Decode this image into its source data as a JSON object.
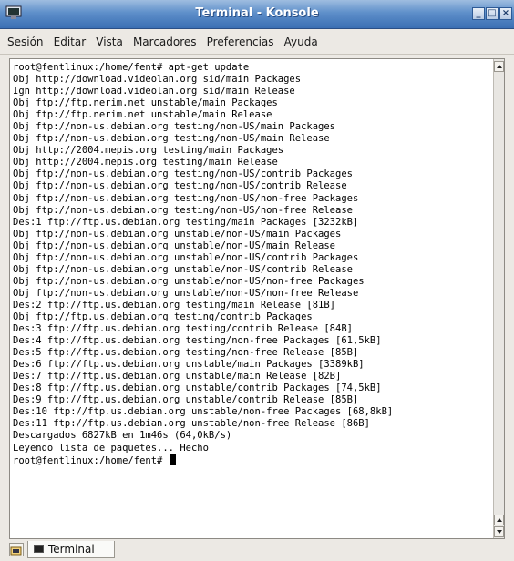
{
  "window": {
    "title": "Terminal - Konsole"
  },
  "menu": [
    "Sesión",
    "Editar",
    "Vista",
    "Marcadores",
    "Preferencias",
    "Ayuda"
  ],
  "terminal": {
    "lines": [
      "root@fentlinux:/home/fent# apt-get update",
      "Obj http://download.videolan.org sid/main Packages",
      "Ign http://download.videolan.org sid/main Release",
      "Obj ftp://ftp.nerim.net unstable/main Packages",
      "Obj ftp://ftp.nerim.net unstable/main Release",
      "Obj ftp://non-us.debian.org testing/non-US/main Packages",
      "Obj ftp://non-us.debian.org testing/non-US/main Release",
      "Obj http://2004.mepis.org testing/main Packages",
      "Obj http://2004.mepis.org testing/main Release",
      "Obj ftp://non-us.debian.org testing/non-US/contrib Packages",
      "Obj ftp://non-us.debian.org testing/non-US/contrib Release",
      "Obj ftp://non-us.debian.org testing/non-US/non-free Packages",
      "Obj ftp://non-us.debian.org testing/non-US/non-free Release",
      "Des:1 ftp://ftp.us.debian.org testing/main Packages [3232kB]",
      "Obj ftp://non-us.debian.org unstable/non-US/main Packages",
      "Obj ftp://non-us.debian.org unstable/non-US/main Release",
      "Obj ftp://non-us.debian.org unstable/non-US/contrib Packages",
      "Obj ftp://non-us.debian.org unstable/non-US/contrib Release",
      "Obj ftp://non-us.debian.org unstable/non-US/non-free Packages",
      "Obj ftp://non-us.debian.org unstable/non-US/non-free Release",
      "Des:2 ftp://ftp.us.debian.org testing/main Release [81B]",
      "Obj ftp://ftp.us.debian.org testing/contrib Packages",
      "Des:3 ftp://ftp.us.debian.org testing/contrib Release [84B]",
      "Des:4 ftp://ftp.us.debian.org testing/non-free Packages [61,5kB]",
      "Des:5 ftp://ftp.us.debian.org testing/non-free Release [85B]",
      "Des:6 ftp://ftp.us.debian.org unstable/main Packages [3389kB]",
      "Des:7 ftp://ftp.us.debian.org unstable/main Release [82B]",
      "Des:8 ftp://ftp.us.debian.org unstable/contrib Packages [74,5kB]",
      "Des:9 ftp://ftp.us.debian.org unstable/contrib Release [85B]",
      "Des:10 ftp://ftp.us.debian.org unstable/non-free Packages [68,8kB]",
      "Des:11 ftp://ftp.us.debian.org unstable/non-free Release [86B]",
      "Descargados 6827kB en 1m46s (64,0kB/s)",
      "Leyendo lista de paquetes... Hecho",
      "root@fentlinux:/home/fent# "
    ]
  },
  "tabbar": {
    "tab_label": "Terminal"
  },
  "icons": {
    "app": "konsole-terminal-icon",
    "minimize": "minimize-icon",
    "maximize": "maximize-icon",
    "close": "close-icon",
    "new_session": "new-session-icon",
    "tab": "terminal-tab-icon"
  },
  "colors": {
    "titlebar": "#3b6fb3",
    "title_text": "#ffffff",
    "window_bg": "#ece9e4",
    "terminal_bg": "#ffffff",
    "terminal_text": "#000000"
  }
}
